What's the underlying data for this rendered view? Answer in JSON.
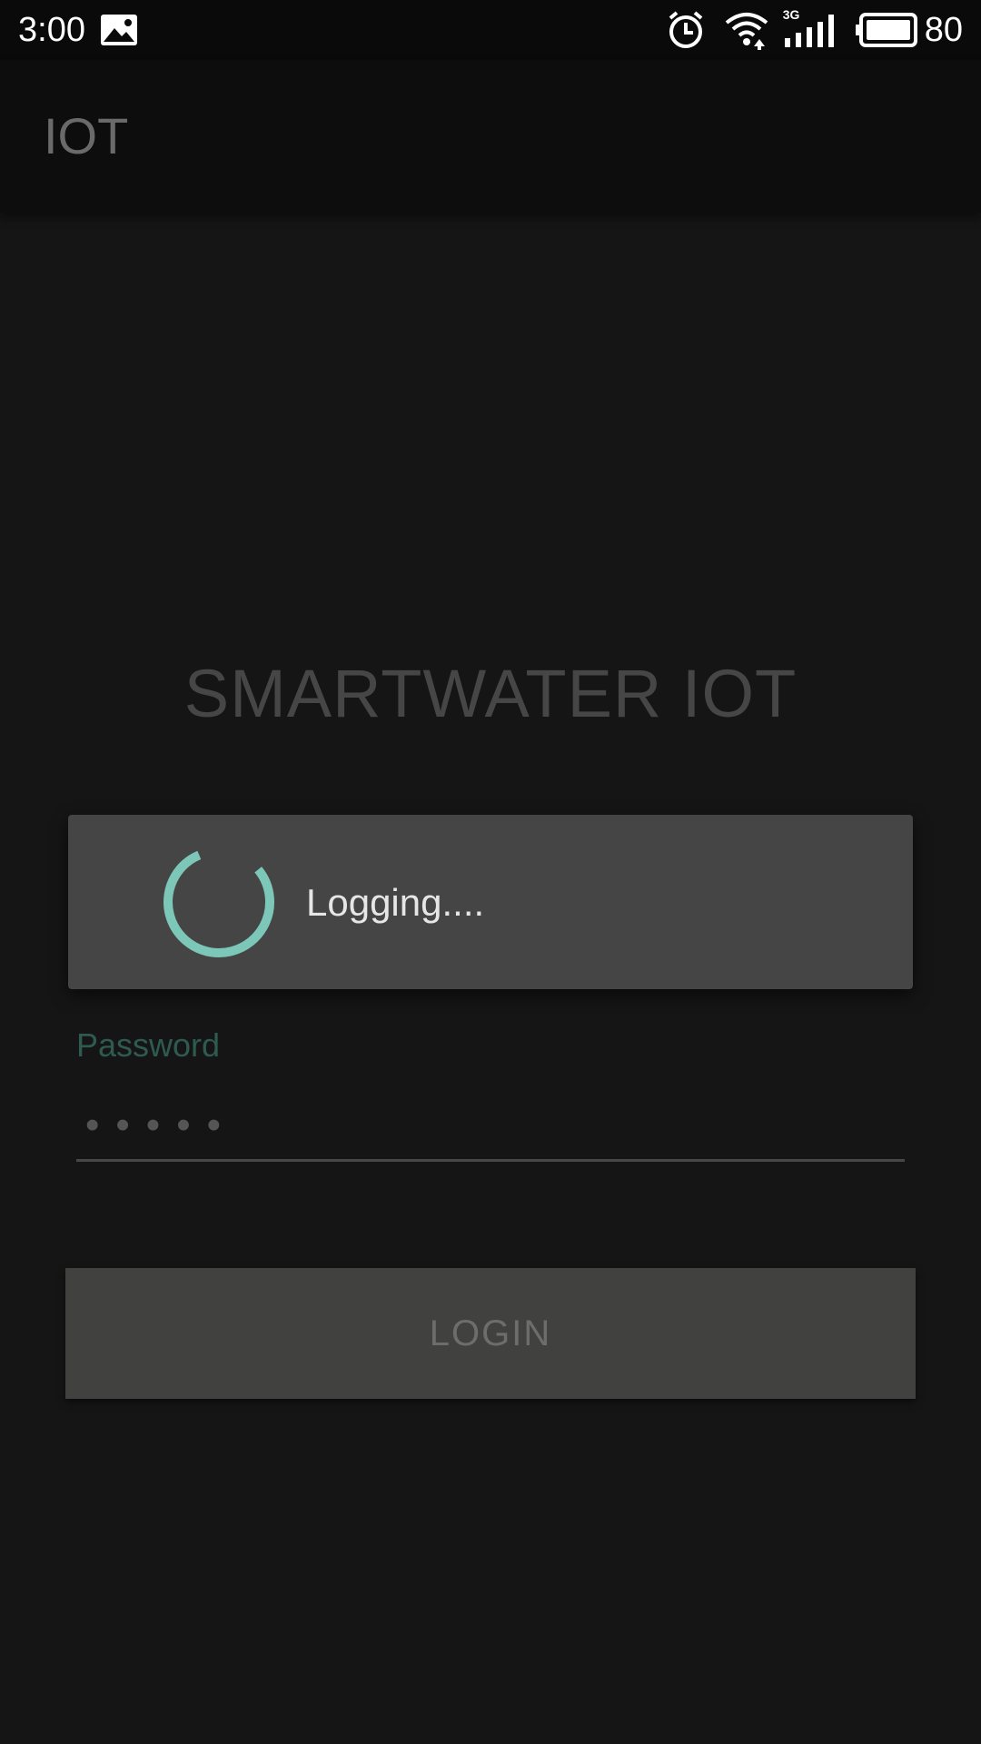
{
  "status_bar": {
    "time": "3:00",
    "network_type": "3G",
    "battery_level": "80",
    "icons": [
      "gallery-icon",
      "alarm-icon",
      "wifi-icon",
      "signal-icon",
      "battery-icon"
    ]
  },
  "app_bar": {
    "title": "IOT"
  },
  "main": {
    "brand_title": "SMARTWATER IOT",
    "password": {
      "label": "Password",
      "value_masked": "•••••"
    },
    "login_button": {
      "label": "LOGIN"
    }
  },
  "dialog": {
    "message": "Logging....",
    "indicator": "spinner-icon"
  },
  "colors": {
    "background": "#151515",
    "accent": "#7cc7b8",
    "dialog_background": "#454545",
    "button_background": "#41413f"
  }
}
